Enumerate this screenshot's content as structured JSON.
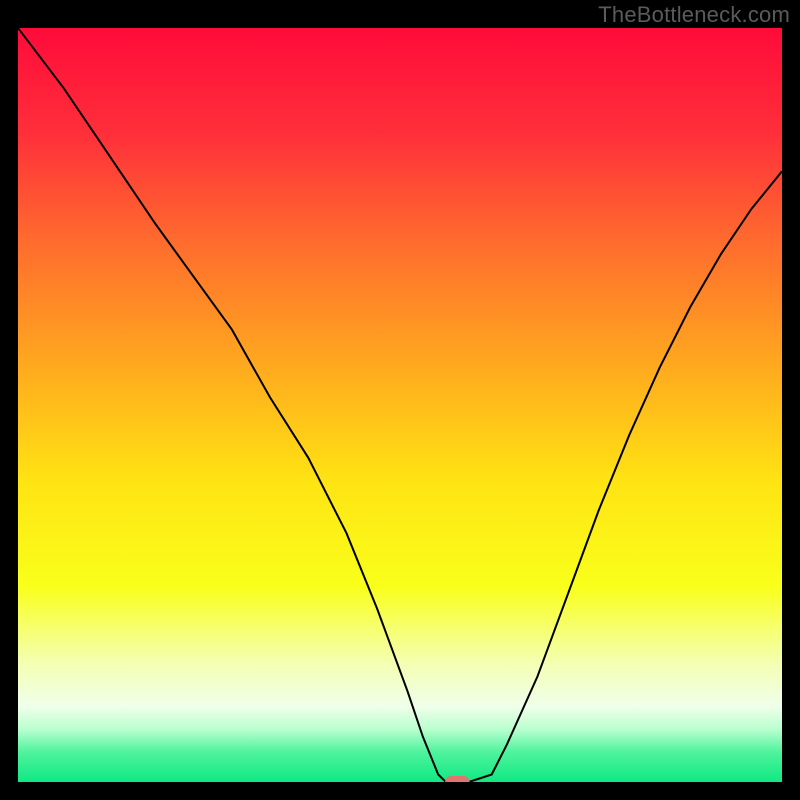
{
  "watermark_text": "TheBottleneck.com",
  "chart_data": {
    "type": "line",
    "title": "",
    "xlabel": "",
    "ylabel": "",
    "xlim": [
      0,
      100
    ],
    "ylim": [
      0,
      100
    ],
    "grid": false,
    "legend": false,
    "annotations": [],
    "background_gradient_stops": [
      {
        "pct": 0,
        "color": "#ff0b3a"
      },
      {
        "pct": 14,
        "color": "#ff2f3a"
      },
      {
        "pct": 28,
        "color": "#ff6a2e"
      },
      {
        "pct": 44,
        "color": "#ffa61f"
      },
      {
        "pct": 60,
        "color": "#ffe313"
      },
      {
        "pct": 74,
        "color": "#f9ff1a"
      },
      {
        "pct": 84,
        "color": "#f4ffb0"
      },
      {
        "pct": 90,
        "color": "#efffea"
      },
      {
        "pct": 93,
        "color": "#b9ffcf"
      },
      {
        "pct": 96,
        "color": "#50f39d"
      },
      {
        "pct": 100,
        "color": "#0fe983"
      }
    ],
    "series": [
      {
        "name": "bottleneck-curve",
        "color": "#000000",
        "stroke_width": 2,
        "x": [
          0,
          6,
          12,
          18,
          23,
          28,
          33,
          38,
          43,
          47,
          51,
          53,
          55,
          56,
          59,
          62,
          64,
          68,
          72,
          76,
          80,
          84,
          88,
          92,
          96,
          100
        ],
        "y": [
          100,
          92,
          83,
          74,
          67,
          60,
          51,
          43,
          33,
          23,
          12,
          6,
          1,
          0,
          0,
          1,
          5,
          14,
          25,
          36,
          46,
          55,
          63,
          70,
          76,
          81
        ]
      }
    ],
    "marker": {
      "name": "optimal-marker",
      "x": 57.5,
      "y": 0,
      "width_pct": 3.2,
      "height_pct": 1.6,
      "color": "#e0746e"
    }
  }
}
